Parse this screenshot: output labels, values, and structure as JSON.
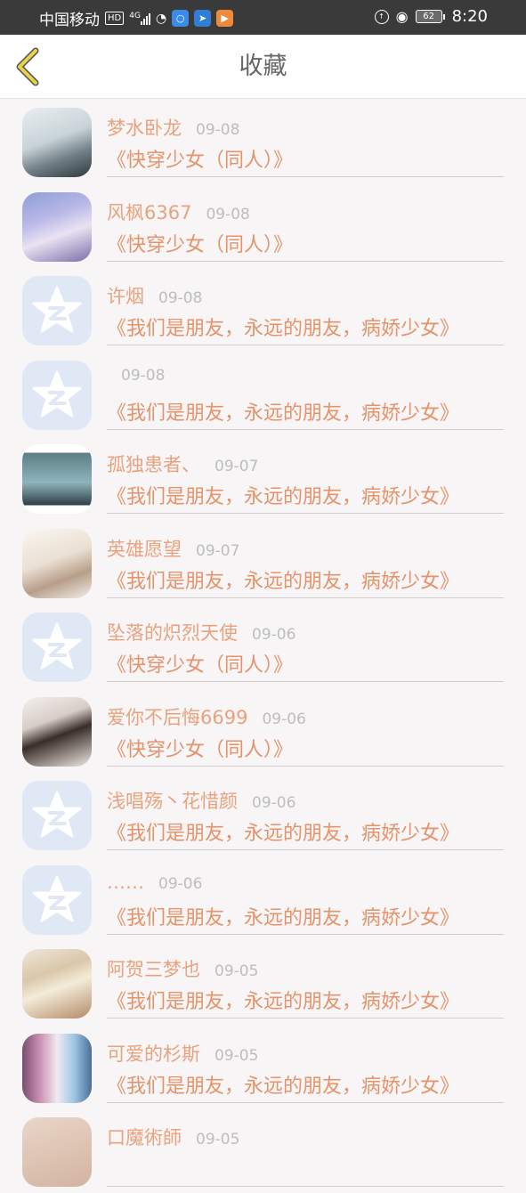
{
  "status_bar": {
    "carrier": "中国移动",
    "hd_badge": "HD",
    "network": "4G",
    "battery": "62",
    "time": "8:20"
  },
  "header": {
    "title": "收藏"
  },
  "favorites": [
    {
      "name": "梦水卧龙",
      "date": "09-08",
      "book": "《快穿少女（同人）》",
      "avatar": "photo"
    },
    {
      "name": "风枫6367",
      "date": "09-08",
      "book": "《快穿少女（同人）》",
      "avatar": "photo"
    },
    {
      "name": "许烟",
      "date": "09-08",
      "book": "《我们是朋友，永远的朋友，病娇少女》",
      "avatar": "default"
    },
    {
      "name": "",
      "date": "09-08",
      "book": "《我们是朋友，永远的朋友，病娇少女》",
      "avatar": "default"
    },
    {
      "name": "孤独患者、",
      "date": "09-07",
      "book": "《我们是朋友，永远的朋友，病娇少女》",
      "avatar": "photo"
    },
    {
      "name": "英雄愿望",
      "date": "09-07",
      "book": "《我们是朋友，永远的朋友，病娇少女》",
      "avatar": "photo"
    },
    {
      "name": "坠落的炽烈天使",
      "date": "09-06",
      "book": "《快穿少女（同人）》",
      "avatar": "default"
    },
    {
      "name": "爱你不后悔6699",
      "date": "09-06",
      "book": "《快穿少女（同人）》",
      "avatar": "photo"
    },
    {
      "name": "浅唱殇丶花惜颜",
      "date": "09-06",
      "book": "《我们是朋友，永远的朋友，病娇少女》",
      "avatar": "default"
    },
    {
      "name": "……",
      "date": "09-06",
      "book": "《我们是朋友，永远的朋友，病娇少女》",
      "avatar": "default"
    },
    {
      "name": "阿贺三梦也",
      "date": "09-05",
      "book": "《我们是朋友，永远的朋友，病娇少女》",
      "avatar": "photo"
    },
    {
      "name": "可爱的杉斯",
      "date": "09-05",
      "book": "《我们是朋友，永远的朋友，病娇少女》",
      "avatar": "photo"
    },
    {
      "name": "口魔術師",
      "date": "09-05",
      "book": "",
      "avatar": "photo"
    }
  ],
  "colors": {
    "name": "#e8a27e",
    "book": "#e4936a",
    "date": "#bdbdbd",
    "back_arrow": "#e8d34a"
  },
  "icons": {
    "back": "chevron-left-icon",
    "default_avatar": "qq-star-icon"
  }
}
